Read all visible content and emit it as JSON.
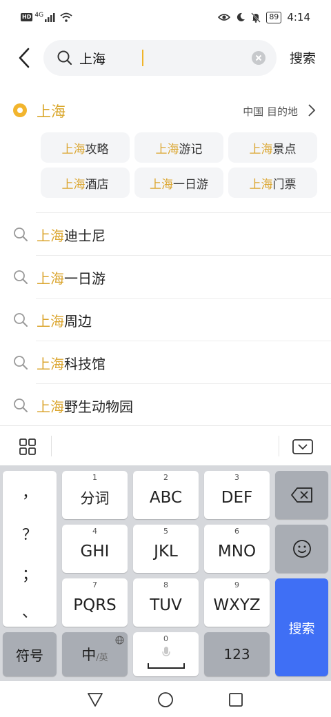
{
  "status_bar": {
    "hd": "HD",
    "network": "4G",
    "battery": "89",
    "time": "4:14"
  },
  "search": {
    "query": "上海",
    "submit_label": "搜索"
  },
  "destination": {
    "name": "上海",
    "meta": "中国 目的地",
    "chips": [
      {
        "hl": "上海",
        "rest": "攻略"
      },
      {
        "hl": "上海",
        "rest": "游记"
      },
      {
        "hl": "上海",
        "rest": "景点"
      },
      {
        "hl": "上海",
        "rest": "酒店"
      },
      {
        "hl": "上海",
        "rest": "一日游"
      },
      {
        "hl": "上海",
        "rest": "门票"
      }
    ]
  },
  "suggestions": [
    {
      "hl": "上海",
      "rest": "迪士尼"
    },
    {
      "hl": "上海",
      "rest": "一日游"
    },
    {
      "hl": "上海",
      "rest": "周边"
    },
    {
      "hl": "上海",
      "rest": "科技馆"
    },
    {
      "hl": "上海",
      "rest": "野生动物园"
    }
  ],
  "keyboard": {
    "punct": [
      "，",
      "？",
      "；",
      "、"
    ],
    "keys": [
      {
        "num": "1",
        "label": "分词"
      },
      {
        "num": "2",
        "label": "ABC"
      },
      {
        "num": "3",
        "label": "DEF"
      },
      {
        "num": "4",
        "label": "GHI"
      },
      {
        "num": "5",
        "label": "JKL"
      },
      {
        "num": "6",
        "label": "MNO"
      },
      {
        "num": "7",
        "label": "PQRS"
      },
      {
        "num": "8",
        "label": "TUV"
      },
      {
        "num": "9",
        "label": "WXYZ"
      }
    ],
    "symbols_label": "符号",
    "lang_main": "中",
    "lang_sub": "/英",
    "space_num": "0",
    "num_label": "123",
    "enter_label": "搜索"
  },
  "colors": {
    "highlight": "#dba630",
    "enter_key": "#3f6ff5"
  }
}
